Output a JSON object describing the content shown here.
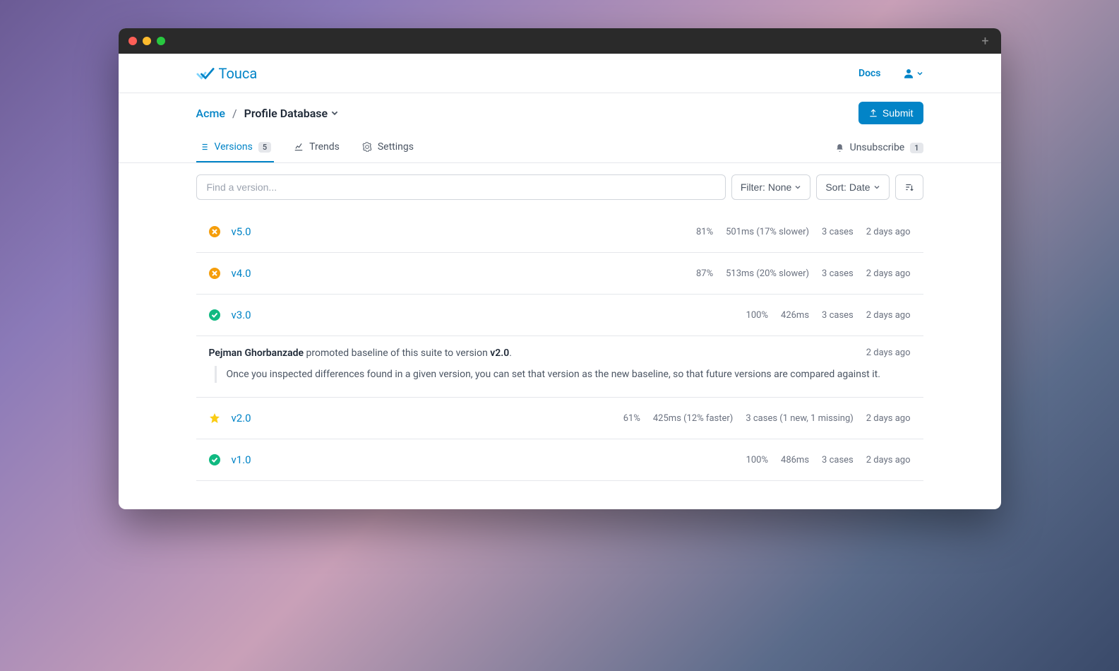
{
  "brand": "Touca",
  "nav": {
    "docs": "Docs"
  },
  "breadcrumb": {
    "team": "Acme",
    "suite": "Profile Database"
  },
  "submit_label": "Submit",
  "tabs": {
    "versions": {
      "label": "Versions",
      "count": "5"
    },
    "trends": {
      "label": "Trends"
    },
    "settings": {
      "label": "Settings"
    }
  },
  "unsubscribe": {
    "label": "Unsubscribe",
    "count": "1"
  },
  "search": {
    "placeholder": "Find a version..."
  },
  "filter": {
    "label": "Filter:",
    "value": "None"
  },
  "sort": {
    "label": "Sort:",
    "value": "Date"
  },
  "versions": [
    {
      "status": "fail",
      "name": "v5.0",
      "score": "81%",
      "perf": "501ms (17% slower)",
      "cases": "3 cases",
      "age": "2 days ago"
    },
    {
      "status": "fail",
      "name": "v4.0",
      "score": "87%",
      "perf": "513ms (20% slower)",
      "cases": "3 cases",
      "age": "2 days ago"
    },
    {
      "status": "pass",
      "name": "v3.0",
      "score": "100%",
      "perf": "426ms",
      "cases": "3 cases",
      "age": "2 days ago"
    },
    {
      "status": "star",
      "name": "v2.0",
      "score": "61%",
      "perf": "425ms (12% faster)",
      "cases": "3 cases (1 new, 1 missing)",
      "age": "2 days ago"
    },
    {
      "status": "pass",
      "name": "v1.0",
      "score": "100%",
      "perf": "486ms",
      "cases": "3 cases",
      "age": "2 days ago"
    }
  ],
  "promotion": {
    "actor": "Pejman Ghorbanzade",
    "middle": " promoted baseline of this suite to version ",
    "version": "v2.0",
    "suffix": ".",
    "age": "2 days ago",
    "note": "Once you inspected differences found in a given version, you can set that version as the new baseline, so that future versions are compared against it."
  }
}
